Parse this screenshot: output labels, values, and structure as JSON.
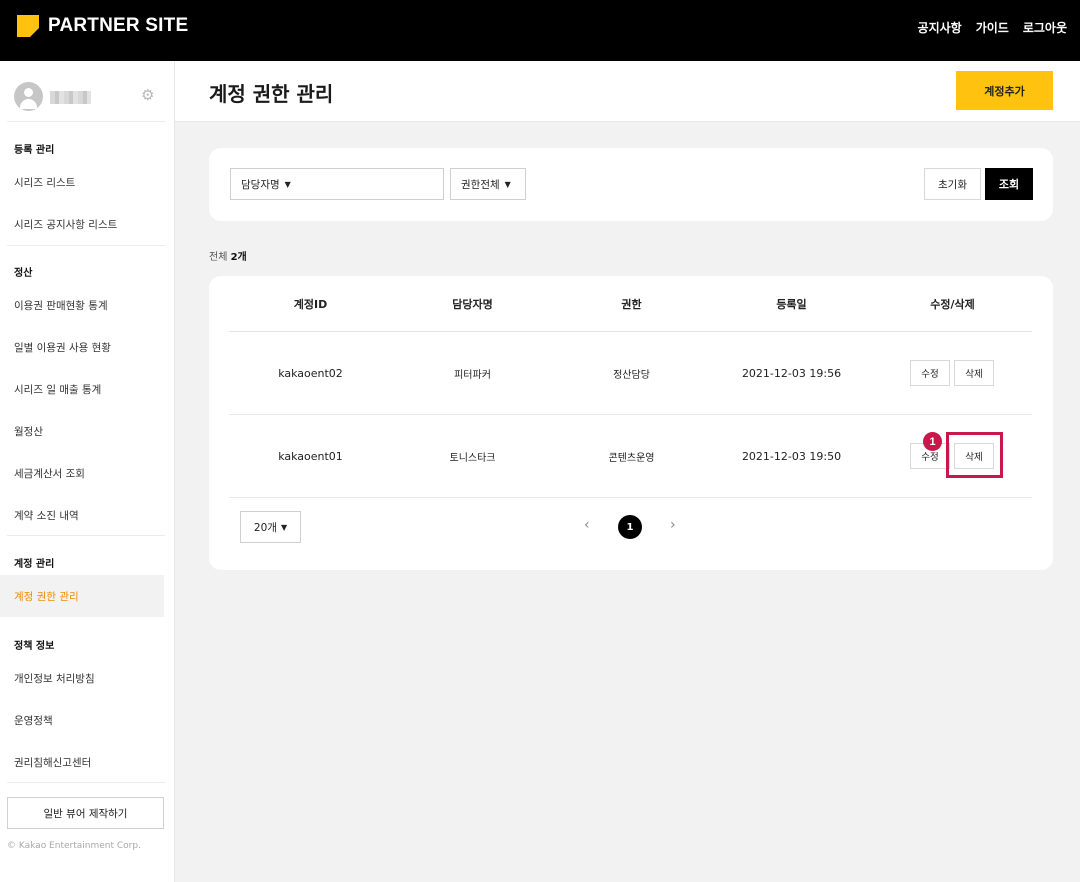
{
  "header": {
    "logo_text": "PARTNER SITE",
    "nav": [
      "공지사항",
      "가이드",
      "로그아웃"
    ]
  },
  "sidebar": {
    "sections": [
      {
        "title": "등록 관리",
        "items": [
          "시리즈 리스트",
          "시리즈 공지사항 리스트"
        ]
      },
      {
        "title": "정산",
        "items": [
          "이용권 판매현황 통계",
          "일별 이용권 사용 현황",
          "시리즈 일 매출 통계",
          "월정산",
          "세금계산서 조회",
          "계약 소진 내역"
        ]
      },
      {
        "title": "계정 관리",
        "items": [
          "계정 권한 관리"
        ]
      },
      {
        "title": "정책 정보",
        "items": [
          "개인정보 처리방침",
          "운영정책",
          "권리침해신고센터"
        ]
      }
    ],
    "bottom_button": "일반 뷰어 제작하기",
    "copyright": "© Kakao Entertainment Corp."
  },
  "page": {
    "title": "계정 권한 관리",
    "add_button": "계정추가"
  },
  "filter": {
    "manager_select": "담당자명",
    "role_select": "권한전체",
    "reset_button": "초기화",
    "search_button": "조회"
  },
  "total": {
    "label": "전체",
    "count": "2개"
  },
  "table": {
    "columns": [
      "계정ID",
      "담당자명",
      "권한",
      "등록일",
      "수정/삭제"
    ],
    "rows": [
      {
        "id": "kakaoent02",
        "manager": "피터파커",
        "role": "정산담당",
        "date": "2021-12-03 19:56"
      },
      {
        "id": "kakaoent01",
        "manager": "토니스타크",
        "role": "콘텐츠운영",
        "date": "2021-12-03 19:50"
      }
    ],
    "edit_label": "수정",
    "delete_label": "삭제"
  },
  "pagination": {
    "page_size": "20개",
    "prev": "‹",
    "next": "›",
    "current": "1"
  },
  "annotation": {
    "step": "1",
    "color": "#c8174b"
  },
  "colors": {
    "accent": "#ffc20e",
    "active_menu": "#f08c00"
  }
}
